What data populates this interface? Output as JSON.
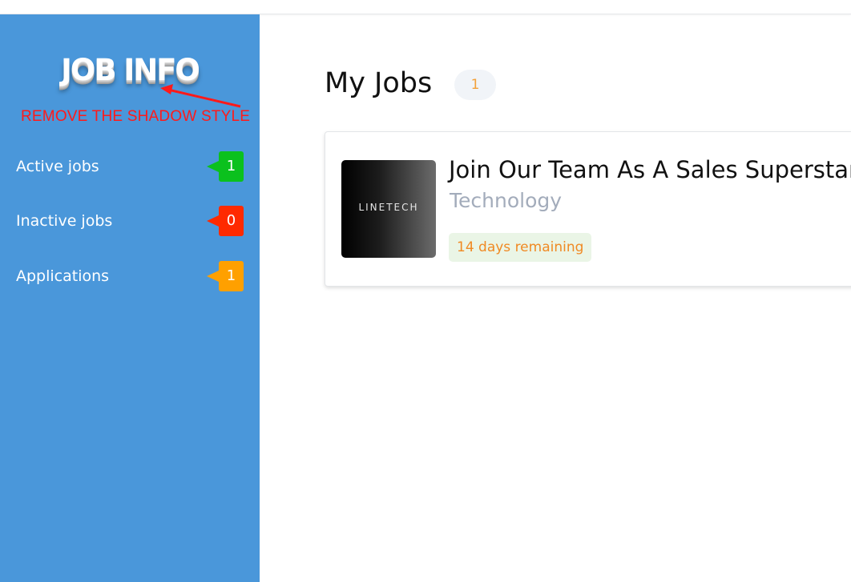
{
  "sidebar": {
    "logo": "JOB INFO",
    "annotation": "REMOVE THE SHADOW STYLE",
    "items": [
      {
        "label": "Active jobs",
        "count": "1",
        "color": "#0bc11d"
      },
      {
        "label": "Inactive jobs",
        "count": "0",
        "color": "#ff2a00"
      },
      {
        "label": "Applications",
        "count": "1",
        "color": "#ffa000"
      }
    ],
    "background": "#4a97da"
  },
  "main": {
    "title": "My Jobs",
    "count": "1",
    "jobs": [
      {
        "company_logo_text": "LINETECH",
        "title": "Join Our Team As A Sales Superstar",
        "category": "Technology",
        "remaining": "14 days remaining"
      }
    ]
  }
}
